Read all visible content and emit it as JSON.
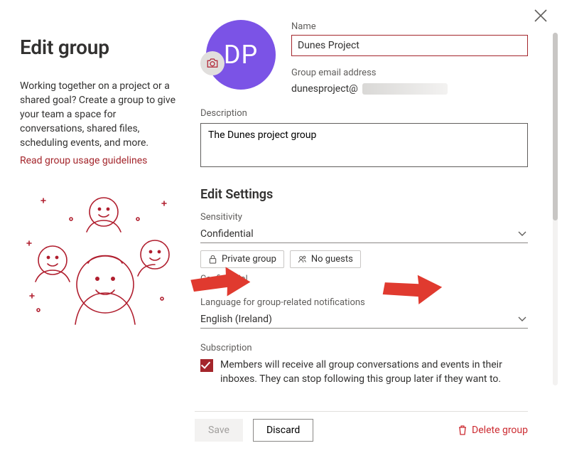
{
  "header": {
    "title": "Edit group"
  },
  "intro": {
    "text": "Working together on a project or a shared goal? Create a group to give your team a space for conversations, shared files, scheduling events, and more.",
    "guidelines_link": "Read group usage guidelines"
  },
  "avatar": {
    "initials": "DP"
  },
  "fields": {
    "name_label": "Name",
    "name_value": "Dunes Project",
    "email_label": "Group email address",
    "email_prefix": "dunesproject@",
    "description_label": "Description",
    "description_value": "The Dunes project group"
  },
  "settings": {
    "heading": "Edit Settings",
    "sensitivity_label": "Sensitivity",
    "sensitivity_value": "Confidential",
    "pill_privacy": "Private group",
    "pill_guests": "No guests",
    "sensitivity_note": "Confidential",
    "language_label": "Language for group-related notifications",
    "language_value": "English (Ireland)"
  },
  "subscription": {
    "label": "Subscription",
    "checked": true,
    "text": "Members will receive all group conversations and events in their inboxes. They can stop following this group later if they want to."
  },
  "footer": {
    "save": "Save",
    "discard": "Discard",
    "delete": "Delete group"
  },
  "icons": {
    "camera": "camera-icon",
    "lock": "lock-icon",
    "people": "people-icon",
    "chevron": "chevron-down-icon",
    "close": "close-icon",
    "trash": "trash-icon"
  }
}
